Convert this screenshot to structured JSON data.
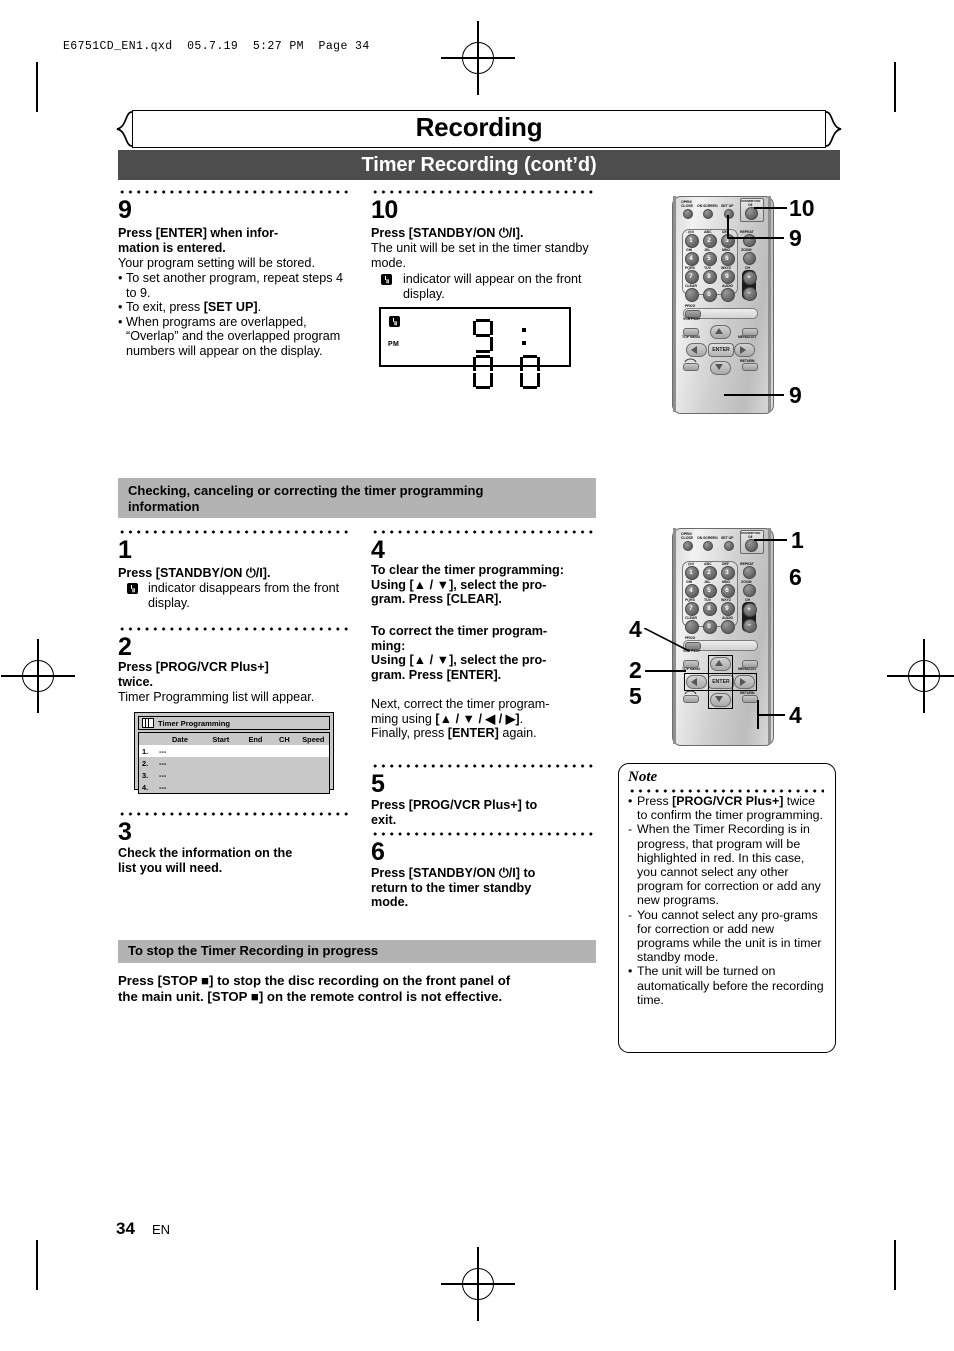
{
  "file_stamp": "E6751CD_EN1.qxd  05.7.19  5:27 PM  Page 34",
  "header": {
    "chapter": "Recording",
    "section": "Timer Recording (cont’d)"
  },
  "steps_top": {
    "step9": {
      "num": "9",
      "heading": "Press [ENTER] when infor-\nmation is entered.",
      "body": "Your program setting will be stored.",
      "bullets": [
        "To set another program, repeat steps 4 to 9.",
        "To exit, press [SET UP].",
        "When programs are overlapped, “Overlap” and the overlapped program numbers will appear on the display."
      ]
    },
    "step10": {
      "num": "10",
      "heading": "Press [STANDBY/ON ⏻/I].",
      "body": "The unit will be set in the timer standby mode.",
      "body2": "indicator will appear on the front display."
    }
  },
  "front_display": {
    "clock_icon": "clock-icon",
    "pm_label": "PM",
    "time": "9:00"
  },
  "section_headings": {
    "checking": "Checking, canceling or correcting the timer programming information",
    "stop_timer": "To stop the Timer Recording in progress"
  },
  "steps_bottom": {
    "step1": {
      "num": "1",
      "heading": "Press [STANDBY/ON ⏻/I].",
      "body": "indicator disappears from the front display."
    },
    "step2": {
      "num": "2",
      "heading": "Press [PROG/VCR Plus+] twice.",
      "body": "Timer Programming list will appear."
    },
    "step3": {
      "num": "3",
      "heading": "Check the information on the list you will need."
    },
    "step4": {
      "num": "4",
      "head_clear": "To clear the timer programming:",
      "line_clear": "Using [▲ / ▼], select the pro-gram. Press [CLEAR].",
      "head_correct": "To correct the timer program-ming:",
      "line_correct": "Using [▲ / ▼], select the pro-gram. Press [ENTER].",
      "body_next": "Next, correct the timer program-ming using [▲ / ▼ / ◀ / ▶].",
      "body_final": "Finally, press [ENTER] again."
    },
    "step5": {
      "num": "5",
      "heading": "Press [PROG/VCR Plus+] to exit."
    },
    "step6": {
      "num": "6",
      "heading": "Press [STANDBY/ON ⏻/I] to return to the timer standby mode."
    }
  },
  "stop_text": "Press [STOP ■] to stop the disc recording on the front panel of the main unit. [STOP ■] on the remote control is not effective.",
  "timer_table": {
    "title": "Timer Programming",
    "columns": [
      "",
      "Date",
      "Start",
      "End",
      "CH",
      "Speed"
    ],
    "rows": [
      {
        "n": "1.",
        "date": "---",
        "start": "",
        "end": "",
        "ch": "",
        "speed": ""
      },
      {
        "n": "2.",
        "date": "---",
        "start": "",
        "end": "",
        "ch": "",
        "speed": ""
      },
      {
        "n": "3.",
        "date": "---",
        "start": "",
        "end": "",
        "ch": "",
        "speed": ""
      },
      {
        "n": "4.",
        "date": "---",
        "start": "",
        "end": "",
        "ch": "",
        "speed": ""
      }
    ]
  },
  "note": {
    "title": "Note",
    "items": [
      {
        "marker": "•",
        "text": "Press [PROG/VCR Plus+] twice to confirm the timer programming."
      },
      {
        "marker": "-",
        "text": "When the Timer Recording is in progress, that program will be highlighted in red. In this case, you cannot select any other program for correction or add any new programs."
      },
      {
        "marker": "-",
        "text": "You cannot select any pro-grams for correction or add new programs while the unit is in timer standby mode."
      },
      {
        "marker": "•",
        "text": "The unit will be turned on automatically before the recording time."
      }
    ]
  },
  "remote": {
    "top_buttons": [
      "OPEN/CLOSE",
      "ON SCREEN",
      "SET UP",
      "STANDBY/ON"
    ],
    "keypad_letters": [
      "@ .-/ 1",
      "ABC",
      "DEF",
      "GHI",
      "JKL",
      "MNO",
      "PQRS",
      "TUV",
      "WXYZ"
    ],
    "keypad_numbers": [
      "1",
      "2",
      "3",
      "4",
      "5",
      "6",
      "7",
      "8",
      "9",
      "0"
    ],
    "side_buttons": [
      "REPEAT",
      "ZOOM",
      "CH"
    ],
    "ch_plus": "+",
    "ch_minus": "−",
    "clear_label": "CLEAR",
    "audio_label": "AUDIO",
    "prog_label": "PROG",
    "vcrplus_label": "VCR Plus+",
    "nav_labels": [
      "TOP MENU",
      "MENU/LIST",
      "RETURN"
    ],
    "enter_label": "ENTER"
  },
  "callouts_top": [
    "10",
    "9",
    "9"
  ],
  "callouts_bottom": [
    "1",
    "6",
    "4",
    "2",
    "5",
    "4"
  ],
  "footer": {
    "page": "34",
    "lang": "EN"
  }
}
